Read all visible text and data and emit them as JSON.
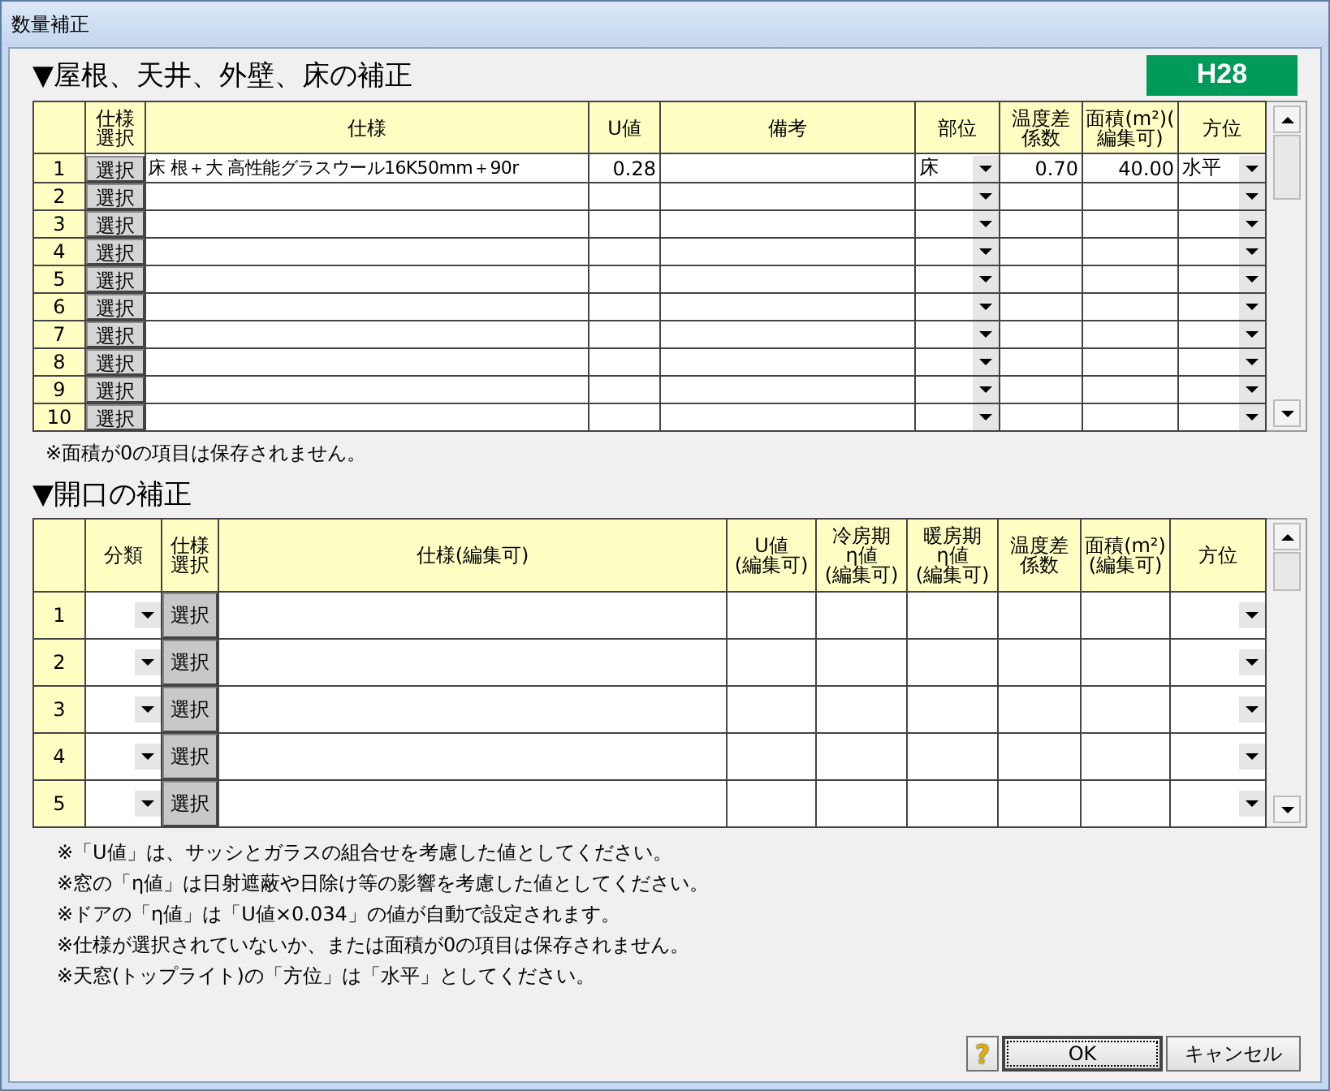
{
  "window": {
    "title": "数量補正"
  },
  "badge": "H28",
  "section1": {
    "title": "▼屋根、天井、外壁、床の補正",
    "columns": [
      "",
      "仕様選択",
      "仕様",
      "U値",
      "備考",
      "部位",
      "温度差係数",
      "面積(m²)(\n編集可)",
      "方位"
    ],
    "rows": [
      {
        "no": "1",
        "select": "選択",
        "spec": "床 根＋大 高性能グラスウール16K50mm＋90r",
        "u_value": "0.28",
        "part": "床",
        "temp_factor": "0.70",
        "area": "40.00",
        "direction": "水平"
      },
      {
        "no": "2",
        "select": "選択"
      },
      {
        "no": "3",
        "select": "選択"
      },
      {
        "no": "4",
        "select": "選択"
      },
      {
        "no": "5",
        "select": "選択"
      },
      {
        "no": "6",
        "select": "選択"
      },
      {
        "no": "7",
        "select": "選択"
      },
      {
        "no": "8",
        "select": "選択"
      },
      {
        "no": "9",
        "select": "選択"
      },
      {
        "no": "10",
        "select": "選択"
      }
    ],
    "note": "※面積が0の項目は保存されません。"
  },
  "section2": {
    "title": "▼開口の補正",
    "columns": [
      "",
      "分類",
      "仕様選択",
      "仕様(編集可)",
      "U値\n(編集可)",
      "冷房期\nη値\n(編集可)",
      "暖房期\nη値\n(編集可)",
      "温度差係数",
      "面積(m²)\n(編集可)",
      "方位"
    ],
    "rows": [
      {
        "no": "1",
        "select": "選択"
      },
      {
        "no": "2",
        "select": "選択"
      },
      {
        "no": "3",
        "select": "選択"
      },
      {
        "no": "4",
        "select": "選択"
      },
      {
        "no": "5",
        "select": "選択"
      }
    ],
    "notes": [
      "※「U値」は、サッシとガラスの組合せを考慮した値としてください。",
      "※窓の「η値」は日射遮蔽や日除け等の影響を考慮した値としてください。",
      "※ドアの「η値」は「U値×0.034」の値が自動で設定されます。",
      "※仕様が選択されていないか、または面積が0の項目は保存されません。",
      "※天窓(トップライト)の「方位」は「水平」としてください。"
    ]
  },
  "buttons": {
    "help": "?",
    "ok": "OK",
    "cancel": "キャンセル"
  }
}
